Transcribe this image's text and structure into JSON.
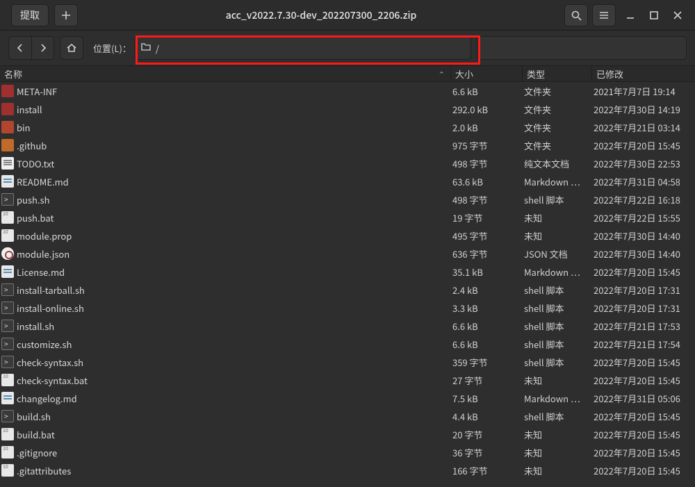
{
  "titlebar": {
    "extract_label": "提取",
    "title": "acc_v2022.7.30-dev_202207300_2206.zip"
  },
  "nav": {
    "location_label": "位置(L)：",
    "path": "/"
  },
  "columns": {
    "name": "名称",
    "size": "大小",
    "type": "类型",
    "modified": "已修改"
  },
  "rows": [
    {
      "icon": "folder-red",
      "name": "META-INF",
      "size": "6.6 kB",
      "type": "文件夹",
      "mod": "2021年7月7日 19:14"
    },
    {
      "icon": "folder-red",
      "name": "install",
      "size": "292.0 kB",
      "type": "文件夹",
      "mod": "2022年7月30日 14:19"
    },
    {
      "icon": "folder-red2",
      "name": "bin",
      "size": "2.0 kB",
      "type": "文件夹",
      "mod": "2022年7月21日 03:14"
    },
    {
      "icon": "folder-orange",
      "name": ".github",
      "size": "975 字节",
      "type": "文件夹",
      "mod": "2022年7月20日 15:45"
    },
    {
      "icon": "txt",
      "name": "TODO.txt",
      "size": "498 字节",
      "type": "纯文本文档",
      "mod": "2022年7月30日 22:53"
    },
    {
      "icon": "md",
      "name": "README.md",
      "size": "63.6 kB",
      "type": "Markdown …",
      "mod": "2022年7月31日 04:58"
    },
    {
      "icon": "sh",
      "name": "push.sh",
      "size": "498 字节",
      "type": "shell 脚本",
      "mod": "2022年7月22日 16:18"
    },
    {
      "icon": "bin",
      "name": "push.bat",
      "size": "19 字节",
      "type": "未知",
      "mod": "2022年7月22日 15:55"
    },
    {
      "icon": "bin",
      "name": "module.prop",
      "size": "495 字节",
      "type": "未知",
      "mod": "2022年7月30日 14:40"
    },
    {
      "icon": "json",
      "name": "module.json",
      "size": "636 字节",
      "type": "JSON 文档",
      "mod": "2022年7月30日 14:40"
    },
    {
      "icon": "md",
      "name": "License.md",
      "size": "35.1 kB",
      "type": "Markdown …",
      "mod": "2022年7月20日 15:45"
    },
    {
      "icon": "sh",
      "name": "install-tarball.sh",
      "size": "2.4 kB",
      "type": "shell 脚本",
      "mod": "2022年7月20日 17:31"
    },
    {
      "icon": "sh",
      "name": "install-online.sh",
      "size": "3.3 kB",
      "type": "shell 脚本",
      "mod": "2022年7月20日 17:31"
    },
    {
      "icon": "sh",
      "name": "install.sh",
      "size": "6.6 kB",
      "type": "shell 脚本",
      "mod": "2022年7月21日 17:53"
    },
    {
      "icon": "sh",
      "name": "customize.sh",
      "size": "6.6 kB",
      "type": "shell 脚本",
      "mod": "2022年7月21日 17:54"
    },
    {
      "icon": "sh",
      "name": "check-syntax.sh",
      "size": "359 字节",
      "type": "shell 脚本",
      "mod": "2022年7月20日 15:45"
    },
    {
      "icon": "bin",
      "name": "check-syntax.bat",
      "size": "27 字节",
      "type": "未知",
      "mod": "2022年7月20日 15:45"
    },
    {
      "icon": "md",
      "name": "changelog.md",
      "size": "7.5 kB",
      "type": "Markdown …",
      "mod": "2022年7月31日 05:06"
    },
    {
      "icon": "sh",
      "name": "build.sh",
      "size": "4.4 kB",
      "type": "shell 脚本",
      "mod": "2022年7月20日 15:45"
    },
    {
      "icon": "bin",
      "name": "build.bat",
      "size": "20 字节",
      "type": "未知",
      "mod": "2022年7月20日 15:45"
    },
    {
      "icon": "bin",
      "name": ".gitignore",
      "size": "36 字节",
      "type": "未知",
      "mod": "2022年7月20日 15:45"
    },
    {
      "icon": "bin",
      "name": ".gitattributes",
      "size": "166 字节",
      "type": "未知",
      "mod": "2022年7月20日 15:45"
    }
  ]
}
